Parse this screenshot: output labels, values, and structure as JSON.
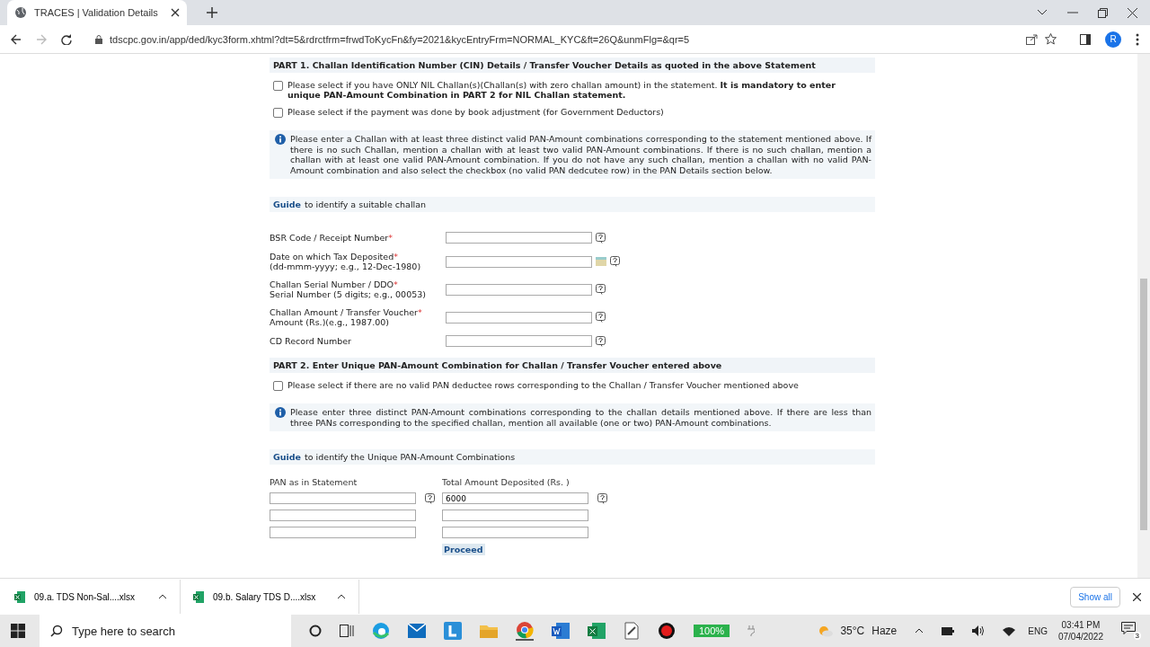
{
  "browser": {
    "tab_title": "TRACES | Validation Details",
    "url": "tdscpc.gov.in/app/ded/kyc3form.xhtml?dt=5&rdrctfrm=frwdToKycFn&fy=2021&kycEntryFrm=NORMAL_KYC&ft=26Q&unmFlg=&qr=5",
    "profile": "R"
  },
  "part1": {
    "heading": "PART 1. Challan Identification Number (CIN) Details / Transfer Voucher Details as quoted in the above Statement",
    "checkboxes": [
      {
        "text": "Please select if you have ONLY NIL Challan(s)(Challan(s) with zero challan amount) in the statement. **It is mandatory to enter unique PAN-Amount Combination in PART 2 for NIL Challan statement.**",
        "checked": false
      },
      {
        "text": "Please select if the payment was done by book adjustment (for Government Deductors)",
        "checked": false
      }
    ],
    "info": "Please enter a Challan with at least three distinct valid PAN-Amount combinations corresponding to the statement mentioned above. If there is no such Challan, mention a challan with at least two valid PAN-Amount combinations. If there is no such challan, mention a challan with at least one valid PAN-Amount combination. If you do not have any such challan, mention a challan with no valid PAN-Amount combination and also select the checkbox (no valid PAN dedcutee row) in the PAN Details section below.",
    "guide_link": "Guide",
    "guide_text": "to identify a suitable challan",
    "fields": [
      {
        "label": "BSR Code / Receipt Number",
        "required_mark": "*",
        "kind": "text"
      },
      {
        "label": "Date on which Tax Deposited",
        "hint": "(dd-mmm-yyyy; e.g., 12-Dec-1980)",
        "required_mark": "*",
        "kind": "date"
      },
      {
        "label": "Challan Serial Number / DDO",
        "hint": "Serial Number (5 digits; e.g., 00053)",
        "required_mark": "*",
        "kind": "text"
      },
      {
        "label": "Challan Amount / Transfer Voucher",
        "hint": "Amount (Rs.)(e.g., 1987.00)",
        "required_mark": "*",
        "kind": "text"
      },
      {
        "label": "CD Record Number",
        "kind": "text"
      }
    ]
  },
  "part2": {
    "heading": "PART 2. Enter Unique PAN-Amount Combination for Challan / Transfer Voucher entered above",
    "checkboxes": [
      {
        "text": "Please select if there are no valid PAN deductee rows corresponding to the Challan / Transfer Voucher mentioned above",
        "checked": false
      }
    ],
    "info": "Please enter three distinct PAN-Amount combinations corresponding to the challan details mentioned above. If there are less than three PANs corresponding to the specified challan, mention all available (one or two) PAN-Amount combinations.",
    "guide_link": "Guide",
    "guide_text": "to identify the Unique PAN-Amount Combinations",
    "col_pan": "PAN as in Statement",
    "col_amount": "Total Amount Deposited (Rs. )",
    "rows": [
      {
        "amount": "6000"
      },
      {
        "amount": ""
      },
      {
        "amount": ""
      }
    ],
    "proceed": "Proceed"
  },
  "downloads": {
    "items": [
      "09.a. TDS Non-Sal....xlsx",
      "09.b. Salary TDS D....xlsx"
    ],
    "show_all": "Show all"
  },
  "taskbar": {
    "search_placeholder": "Type here to search",
    "battery": "100%",
    "temperature": "35°C",
    "weather": "Haze",
    "language": "ENG",
    "time": "03:41 PM",
    "date": "07/04/2022",
    "notifications": "3"
  }
}
